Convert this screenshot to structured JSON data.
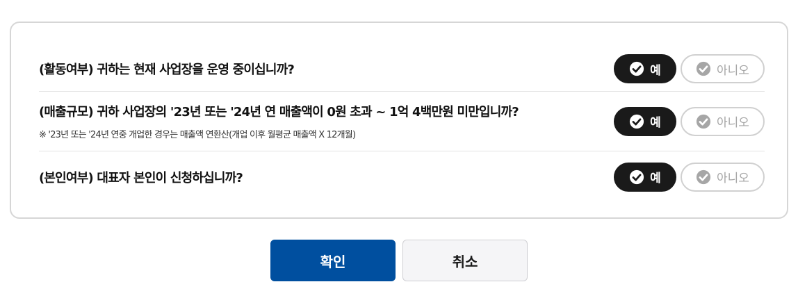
{
  "questions": [
    {
      "text": "(활동여부) 귀하는 현재 사업장을 운영 중이십니까?",
      "note": "",
      "yes_label": "예",
      "no_label": "아니오",
      "selected": "yes"
    },
    {
      "text": "(매출규모) 귀하 사업장의 '23년 또는 '24년 연 매출액이 0원 초과 ~ 1억 4백만원 미만입니까?",
      "note": "※ '23년 또는 '24년 연중 개업한 경우는 매출액 연환산(개업 이후 월평균 매출액 X 12개월)",
      "yes_label": "예",
      "no_label": "아니오",
      "selected": "yes"
    },
    {
      "text": "(본인여부) 대표자 본인이 신청하십니까?",
      "note": "",
      "yes_label": "예",
      "no_label": "아니오",
      "selected": "yes"
    }
  ],
  "actions": {
    "confirm_label": "확인",
    "cancel_label": "취소"
  },
  "colors": {
    "selected_bg": "#1a1a1a",
    "confirm_bg": "#004f9f",
    "cancel_bg": "#f5f5f7",
    "unselected_text": "#a6a6a6"
  },
  "icons": {
    "yes": "check-circle-icon",
    "no": "check-circle-icon"
  }
}
